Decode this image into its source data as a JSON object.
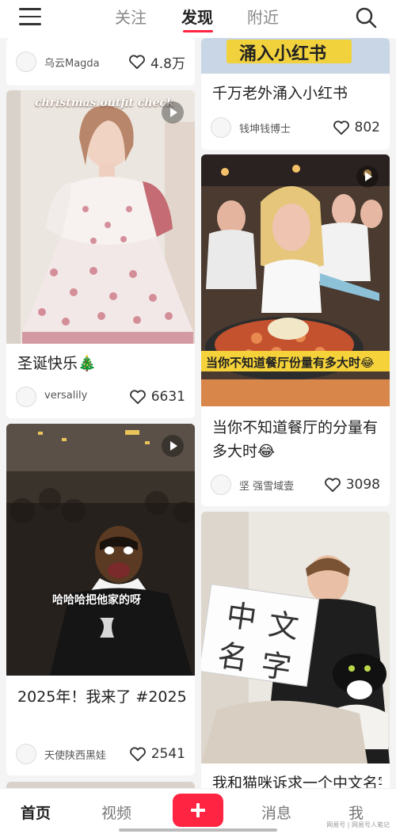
{
  "header": {
    "tabs": [
      "关注",
      "发现",
      "附近"
    ],
    "active_tab": "发现"
  },
  "feed": {
    "left": [
      {
        "author": "乌云Magda",
        "likes": "4.8万"
      },
      {
        "image_caption": "christmas outfit check",
        "title": "圣诞快乐🎄",
        "author": "versalily",
        "likes": "6631"
      },
      {
        "image_caption": "哈哈哈把他家的呀",
        "title": "2025年！我来了 #2025",
        "author": "天使陕西黑娃",
        "likes": "2541"
      }
    ],
    "right": [
      {
        "image_caption": "涌入小红书",
        "title": "千万老外涌入小红书",
        "author": "钱坤钱博士",
        "likes": "802"
      },
      {
        "image_caption": "当你不知道餐厅份量有多大时😂",
        "title": "当你不知道餐厅的分量有多大时😂",
        "author": "坚 强雪域壹",
        "likes": "3098"
      },
      {
        "sign_text": [
          "中",
          "文",
          "名",
          "字"
        ],
        "title": "我和猫咪诉求一个中文名字"
      }
    ]
  },
  "bottom_nav": {
    "items": [
      "首页",
      "视频",
      "消息",
      "我"
    ],
    "active": "首页"
  },
  "watermark": "网易号 | 网易号人笔记",
  "colors": {
    "accent": "#ff2442"
  }
}
